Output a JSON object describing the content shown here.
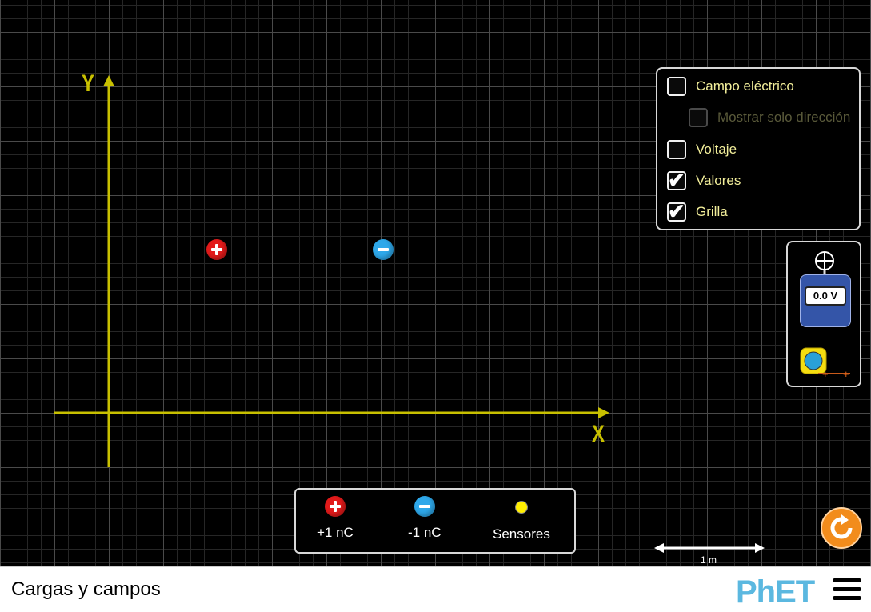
{
  "sim": {
    "axis_x_label": "X",
    "axis_y_label": "Y",
    "charges": [
      {
        "type": "positive",
        "icon": "plus-charge-icon"
      },
      {
        "type": "negative",
        "icon": "minus-charge-icon"
      }
    ]
  },
  "controls": {
    "electric_field": {
      "label": "Campo eléctrico",
      "checked": false
    },
    "direction_only": {
      "label": "Mostrar solo dirección",
      "checked": false,
      "enabled": false
    },
    "voltage": {
      "label": "Voltaje",
      "checked": false
    },
    "values": {
      "label": "Valores",
      "checked": true
    },
    "grid": {
      "label": "Grilla",
      "checked": true
    }
  },
  "toolbox": {
    "voltmeter_reading": "0.0 V"
  },
  "palette": {
    "positive_label": "+1 nC",
    "negative_label": "-1 nC",
    "sensors_label": "Sensores"
  },
  "scale": {
    "label": "1 m"
  },
  "navbar": {
    "title": "Cargas y campos",
    "logo": "PhET"
  },
  "colors": {
    "positive": "#e21a1a",
    "negative": "#2ea8ea",
    "axis": "#c8c000",
    "label_text": "#f2ee9a",
    "reset": "#f28c1c",
    "logo": "#5bb8e0"
  }
}
